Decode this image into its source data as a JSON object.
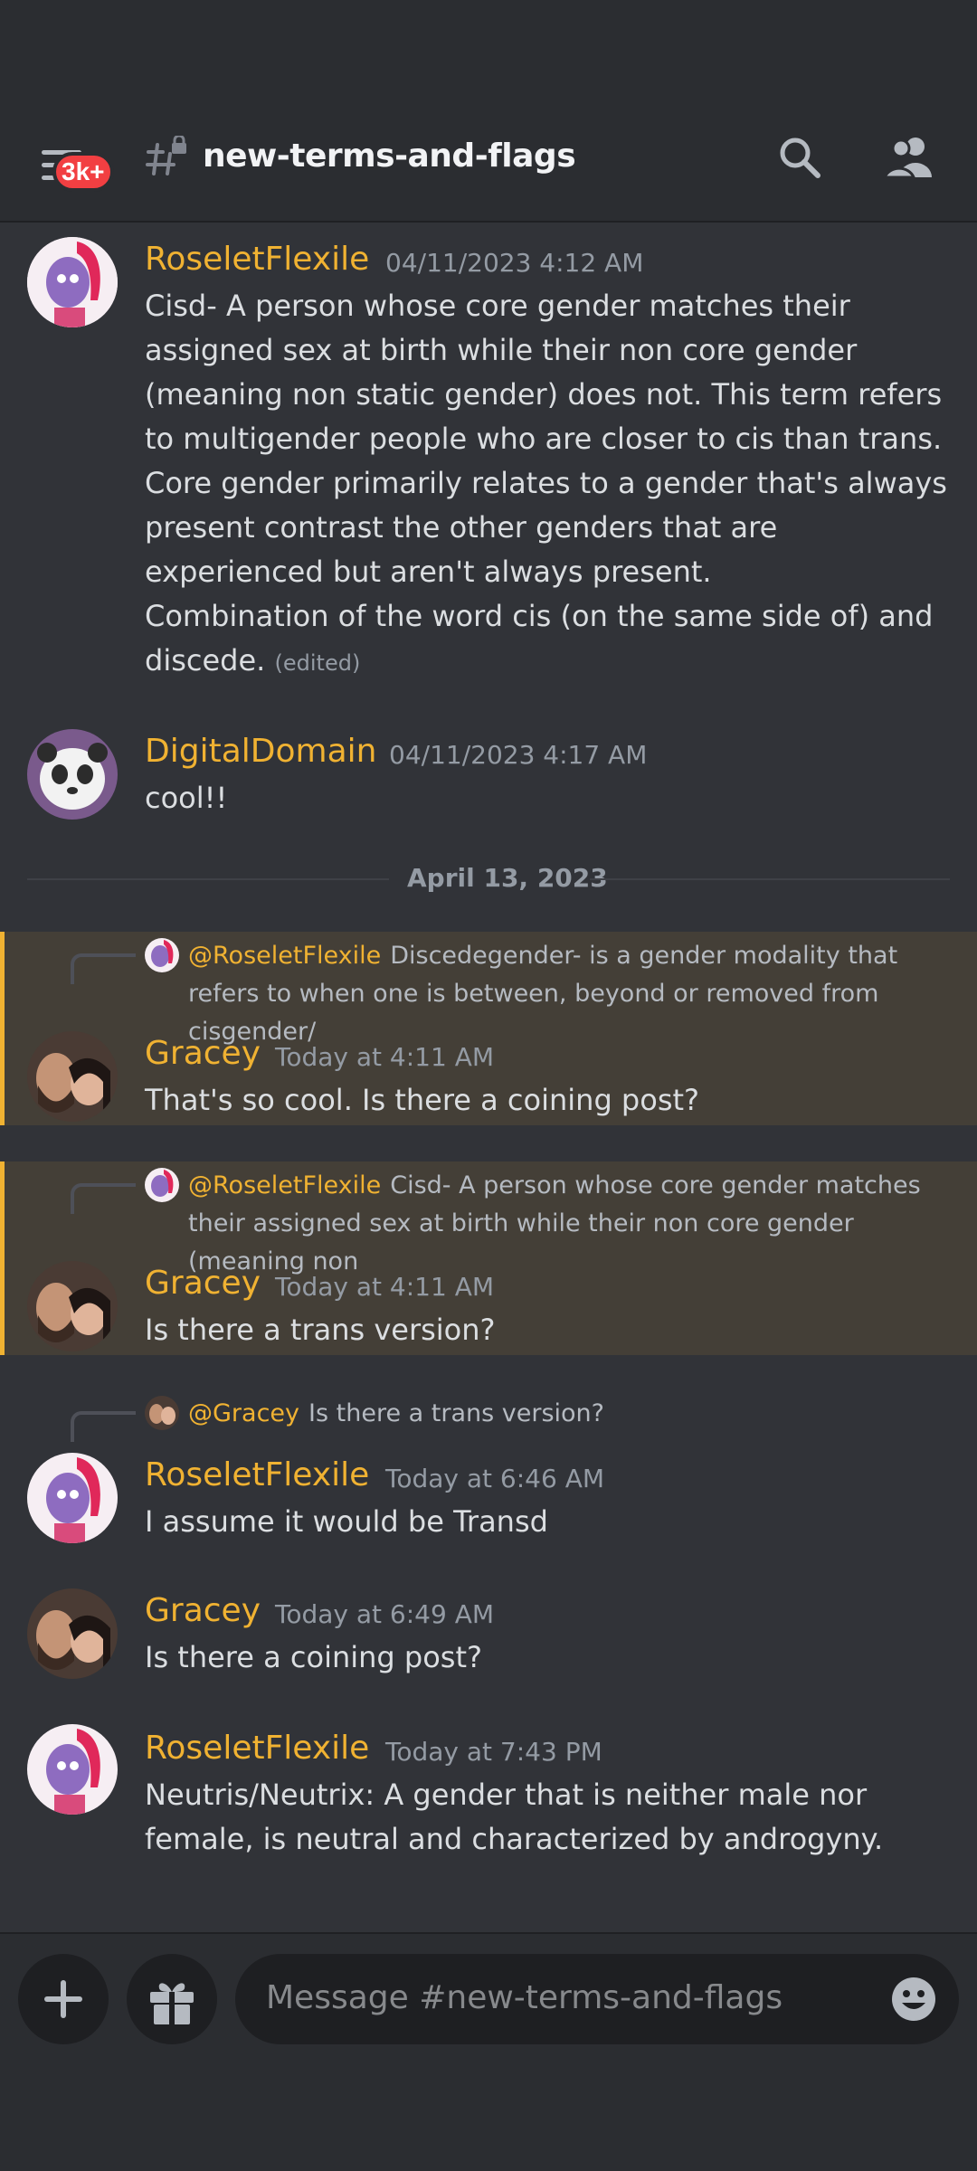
{
  "header": {
    "unread_badge": "3k+",
    "channel_name": "new-terms-and-flags"
  },
  "messages": [
    {
      "author": "RoseletFlexile",
      "timestamp": "04/11/2023 4:12 AM",
      "paragraphs": [
        "Cisd- A person whose core gender matches their assigned sex at birth while their non core gender (meaning non static gender) does not. This term refers to multigender people who are closer to cis than trans.",
        "Core gender primarily relates to a gender that's always present contrast the other genders that are experienced but aren't always present.",
        "Combination of the word cis (on the same side of) and discede."
      ],
      "edited_label": "(edited)"
    },
    {
      "author": "DigitalDomain",
      "timestamp": "04/11/2023 4:17 AM",
      "text": "cool!!"
    },
    {
      "author": "Gracey",
      "timestamp": "Today at 4:11 AM",
      "text": "That's so cool. Is there a coining post?",
      "reply_to": "@RoseletFlexile",
      "reply_text": "Discedegender-  is a gender modality that refers to when one is between, beyond or removed from cisgender/"
    },
    {
      "author": "Gracey",
      "timestamp": "Today at 4:11 AM",
      "text": "Is there a trans version?",
      "reply_to": "@RoseletFlexile",
      "reply_text": "Cisd- A person whose core gender matches their assigned sex at birth while their non core gender (meaning non"
    },
    {
      "author": "RoseletFlexile",
      "timestamp": "Today at 6:46 AM",
      "text": "I assume it would be Transd",
      "reply_to": "@Gracey",
      "reply_text": "Is there a trans version?"
    },
    {
      "author": "Gracey",
      "timestamp": "Today at 6:49 AM",
      "text": "Is there a coining post?"
    },
    {
      "author": "RoseletFlexile",
      "timestamp": "Today at 7:43 PM",
      "text": "Neutris/Neutrix: A gender that is neither male nor female, is neutral and characterized by androgyny."
    }
  ],
  "date_divider": "April 13, 2023",
  "composer": {
    "placeholder": "Message #new-terms-and-flags"
  },
  "colors": {
    "username": "#f0b232",
    "mention_highlight": "#443f37",
    "badge": "#f23f42",
    "background": "#313338"
  },
  "icons": [
    "menu-icon",
    "channel-lock-hash-icon",
    "search-icon",
    "members-icon",
    "plus-icon",
    "gift-icon",
    "emoji-icon"
  ]
}
